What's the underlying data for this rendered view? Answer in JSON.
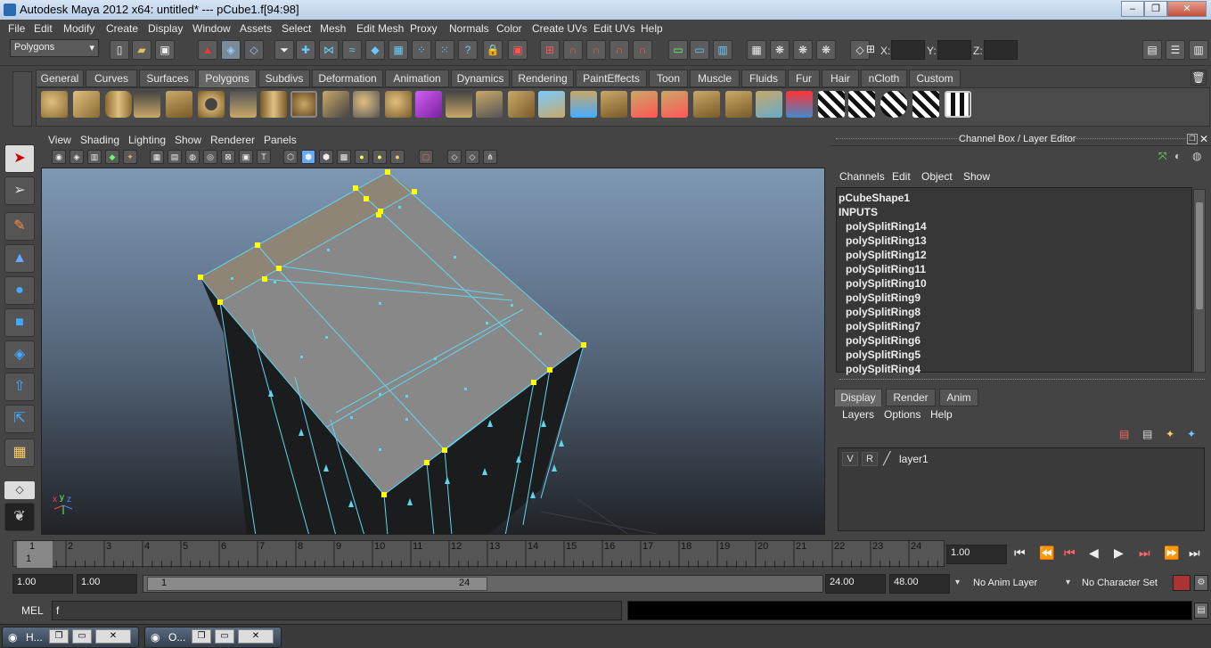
{
  "window": {
    "title": "Autodesk Maya 2012 x64: untitled*   ---   pCube1.f[94:98]",
    "minimize": "–",
    "restore": "❐",
    "close": "✕"
  },
  "menubar": [
    "File",
    "Edit",
    "Modify",
    "Create",
    "Display",
    "Window",
    "Assets",
    "Select",
    "Mesh",
    "Edit Mesh",
    "Proxy",
    "Normals",
    "Color",
    "Create UVs",
    "Edit UVs",
    "Help"
  ],
  "statusline": {
    "mode": "Polygons",
    "x_label": "X:",
    "y_label": "Y:",
    "z_label": "Z:"
  },
  "shelf_tabs": [
    "General",
    "Curves",
    "Surfaces",
    "Polygons",
    "Subdivs",
    "Deformation",
    "Animation",
    "Dynamics",
    "Rendering",
    "PaintEffects",
    "Toon",
    "Muscle",
    "Fluids",
    "Fur",
    "Hair",
    "nCloth",
    "Custom"
  ],
  "shelf_active": "Polygons",
  "panel_menu": [
    "View",
    "Shading",
    "Lighting",
    "Show",
    "Renderer",
    "Panels"
  ],
  "channel_box": {
    "header": "Channel Box / Layer Editor",
    "menu": [
      "Channels",
      "Edit",
      "Object",
      "Show"
    ],
    "items": [
      "pCubeShape1",
      "INPUTS",
      "polySplitRing14",
      "polySplitRing13",
      "polySplitRing12",
      "polySplitRing11",
      "polySplitRing10",
      "polySplitRing9",
      "polySplitRing8",
      "polySplitRing7",
      "polySplitRing6",
      "polySplitRing5",
      "polySplitRing4"
    ]
  },
  "layer_editor": {
    "tabs": [
      "Display",
      "Render",
      "Anim"
    ],
    "menu": [
      "Layers",
      "Options",
      "Help"
    ],
    "layer": {
      "v": "V",
      "r": "R",
      "name": "layer1"
    }
  },
  "timeline": {
    "ticks": [
      "1",
      "2",
      "3",
      "4",
      "5",
      "6",
      "7",
      "8",
      "9",
      "10",
      "11",
      "12",
      "13",
      "14",
      "15",
      "16",
      "17",
      "18",
      "19",
      "20",
      "21",
      "22",
      "23",
      "24"
    ],
    "current_frame_marker": "1",
    "current_time": "1.00"
  },
  "range": {
    "start": "1.00",
    "playback_start": "1.00",
    "slider_start": "1",
    "slider_end": "24",
    "playback_end": "24.00",
    "end": "48.00",
    "anim_layer": "No Anim Layer",
    "character_set": "No Character Set"
  },
  "cmdline": {
    "label": "MEL",
    "value": "f"
  },
  "taskbar": [
    {
      "label": "H..."
    },
    {
      "label": "O..."
    }
  ],
  "colors": {
    "selection_yellow": "#ffff00",
    "wire_cyan": "#5fd6f0",
    "face_selected": "#8f8577"
  }
}
